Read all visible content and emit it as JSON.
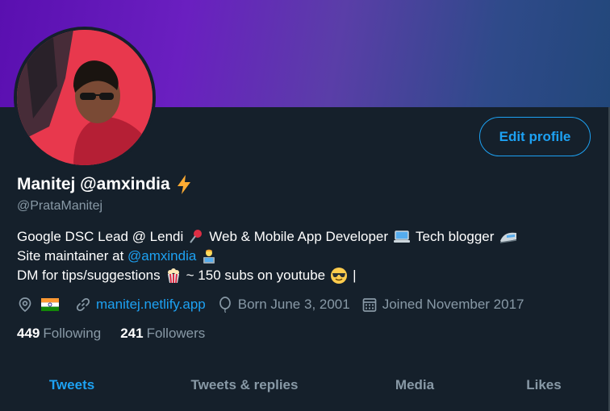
{
  "profile": {
    "display_name": "Manitej @amxindia",
    "handle": "@PrataManitej",
    "edit_button_label": "Edit profile"
  },
  "bio": {
    "line1": {
      "part1": "Google DSC Lead @ Lendi",
      "part2": "Web & Mobile App Developer",
      "part3": "Tech blogger"
    },
    "line2": {
      "prefix": "Site maintainer at ",
      "mention": "@amxindia"
    },
    "line3": {
      "part1": "DM for tips/suggestions",
      "part2": "~ 150 subs on youtube",
      "cursor": "|"
    }
  },
  "meta": {
    "website": "manitej.netlify.app",
    "born": "Born June 3, 2001",
    "joined": "Joined November 2017"
  },
  "stats": {
    "following_count": "449",
    "following_label": "Following",
    "followers_count": "241",
    "followers_label": "Followers"
  },
  "tabs": [
    {
      "label": "Tweets",
      "active": true
    },
    {
      "label": "Tweets & replies",
      "active": false
    },
    {
      "label": "Media",
      "active": false
    },
    {
      "label": "Likes",
      "active": false
    }
  ],
  "colors": {
    "background": "#15202b",
    "accent": "#1da1f2",
    "secondary_text": "#8899a6"
  }
}
